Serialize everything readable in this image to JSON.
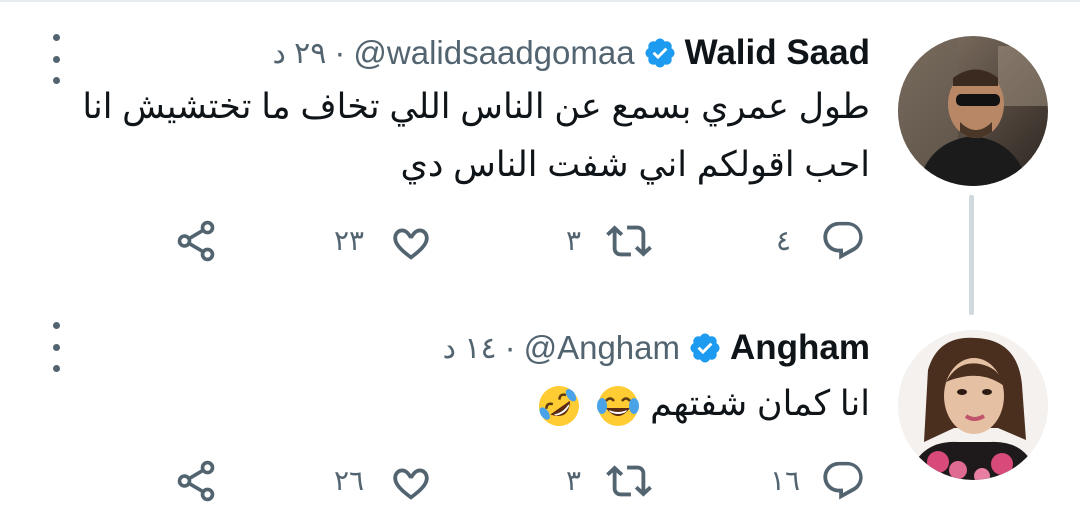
{
  "colors": {
    "text": "#0f1419",
    "secondary": "#536471",
    "verified": "#1d9bf0",
    "thread_line": "#cfd9de"
  },
  "tweets": [
    {
      "name": "Walid Saad",
      "handle": "@walidsaadgomaa",
      "separator": "·",
      "time": "٢٩ د",
      "text_lines": [
        "طول عمري بسمع عن الناس اللي تخاف ما تختشيش انا",
        "احب اقولكم اني شفت الناس دي"
      ],
      "replies": "٤",
      "retweets": "٣",
      "likes": "٢٣",
      "icons": {
        "avatar": "avatar-photo",
        "verified": "verified-badge-icon",
        "more": "more-vertical-icon"
      }
    },
    {
      "name": "Angham",
      "handle": "@Angham",
      "separator": "·",
      "time": "١٤ د",
      "text": "انا كمان شفتهم",
      "emojis": [
        "face-with-tears-of-joy",
        "rolling-on-the-floor-laughing"
      ],
      "replies": "١٦",
      "retweets": "٣",
      "likes": "٢٦",
      "icons": {
        "avatar": "avatar-photo",
        "verified": "verified-badge-icon",
        "more": "more-vertical-icon"
      }
    }
  ],
  "action_icons": [
    "reply-icon",
    "retweet-icon",
    "like-icon",
    "share-icon"
  ]
}
